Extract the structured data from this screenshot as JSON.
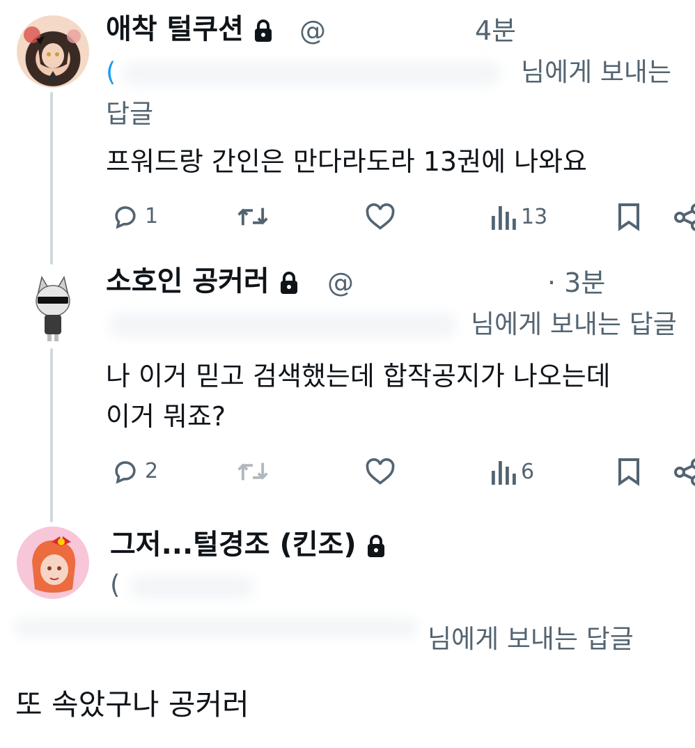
{
  "replies": [
    {
      "display_name": "애착 털쿠션",
      "handle_prefix": "@",
      "time": "4분",
      "replying_to_prefix": "(",
      "replying_to_suffix": "님에게 보내는",
      "replying_to_wrap": "답글",
      "text": "프워드랑 간인은 만다라도라 13권에 나와요",
      "counts": {
        "replies": "1",
        "reposts": "",
        "likes": "",
        "views": "13"
      },
      "avatar_colors": [
        "#f4d9c6",
        "#3b2a24",
        "#c9423a"
      ]
    },
    {
      "display_name": "소호인 공커러",
      "handle_prefix": "@",
      "time": "· 3분",
      "replying_to_suffix": "님에게 보내는 답글",
      "text_line1": "나 이거 믿고 검색했는데 합작공지가 나오는데",
      "text_line2": "이거 뭐죠?",
      "counts": {
        "replies": "2",
        "reposts": "",
        "likes": "",
        "views": "6"
      },
      "avatar_colors": [
        "#eeeeee",
        "#444444",
        "#222222"
      ]
    },
    {
      "display_name": "그저...털경조 (킨조)",
      "replying_to_prefix": "(",
      "replying_to_suffix": "님에게 보내는 답글",
      "avatar_colors": [
        "#f7c6d9",
        "#e9483f",
        "#f08a5d"
      ]
    }
  ],
  "caption": "또 속았구나 공커러",
  "colors": {
    "text": "#0f1419",
    "muted": "#536471",
    "thread_line": "#cfd9de",
    "link": "#1d9bf0"
  }
}
